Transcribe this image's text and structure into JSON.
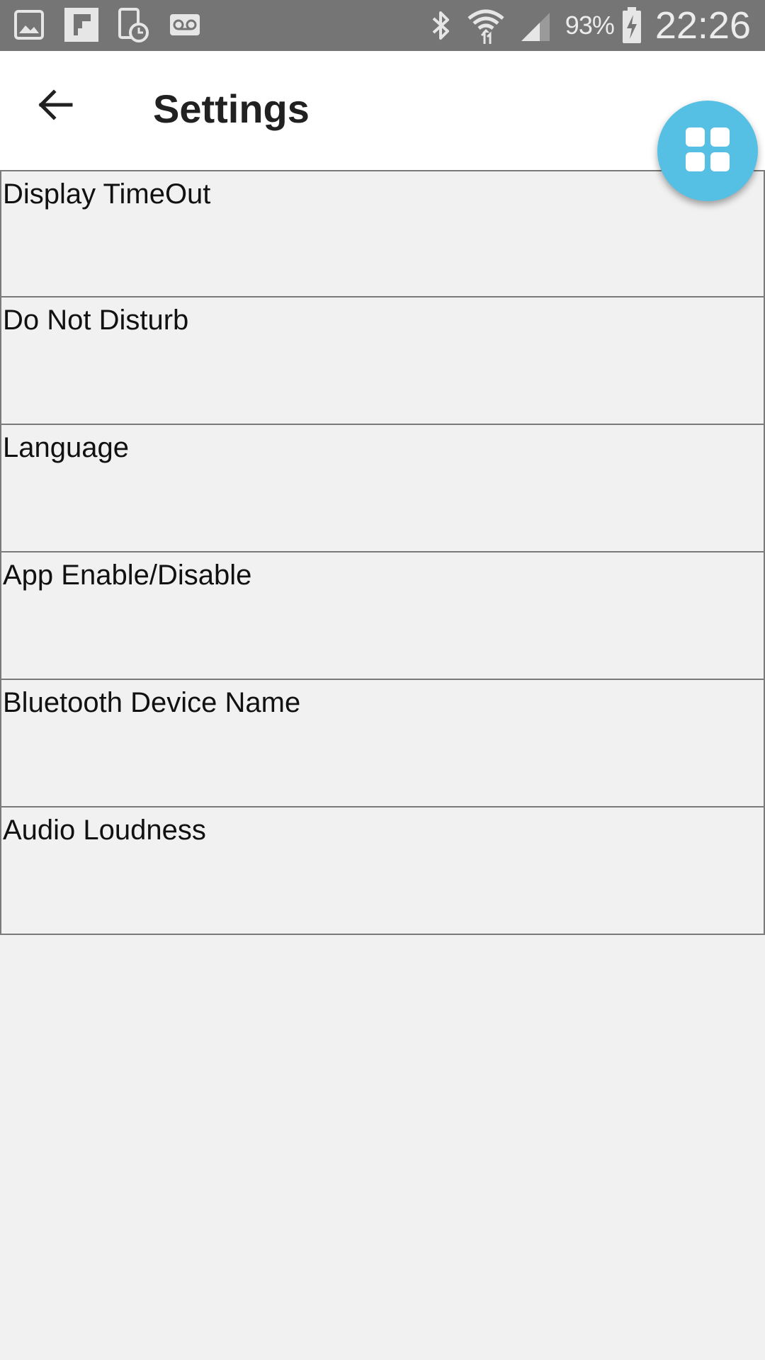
{
  "status_bar": {
    "left_icons": [
      "gallery-icon",
      "flipboard-icon",
      "device-clock-icon",
      "voicemail-icon"
    ],
    "right_icons": [
      "bluetooth-icon",
      "wifi-icon",
      "signal-icon",
      "battery-charging-icon"
    ],
    "battery_percent": "93%",
    "time": "22:26"
  },
  "app_bar": {
    "back_icon": "back-arrow-icon",
    "title": "Settings"
  },
  "fab": {
    "icon": "grid-icon",
    "color": "#56c0e4"
  },
  "settings": {
    "items": [
      {
        "label": "Display TimeOut"
      },
      {
        "label": "Do Not Disturb"
      },
      {
        "label": "Language"
      },
      {
        "label": "App Enable/Disable"
      },
      {
        "label": "Bluetooth Device Name"
      },
      {
        "label": "Audio Loudness"
      }
    ]
  },
  "colors": {
    "status_bar": "#757575",
    "app_bar": "#ffffff",
    "background": "#f1f1f1",
    "divider": "#7a7a7a",
    "accent": "#56c0e4"
  }
}
